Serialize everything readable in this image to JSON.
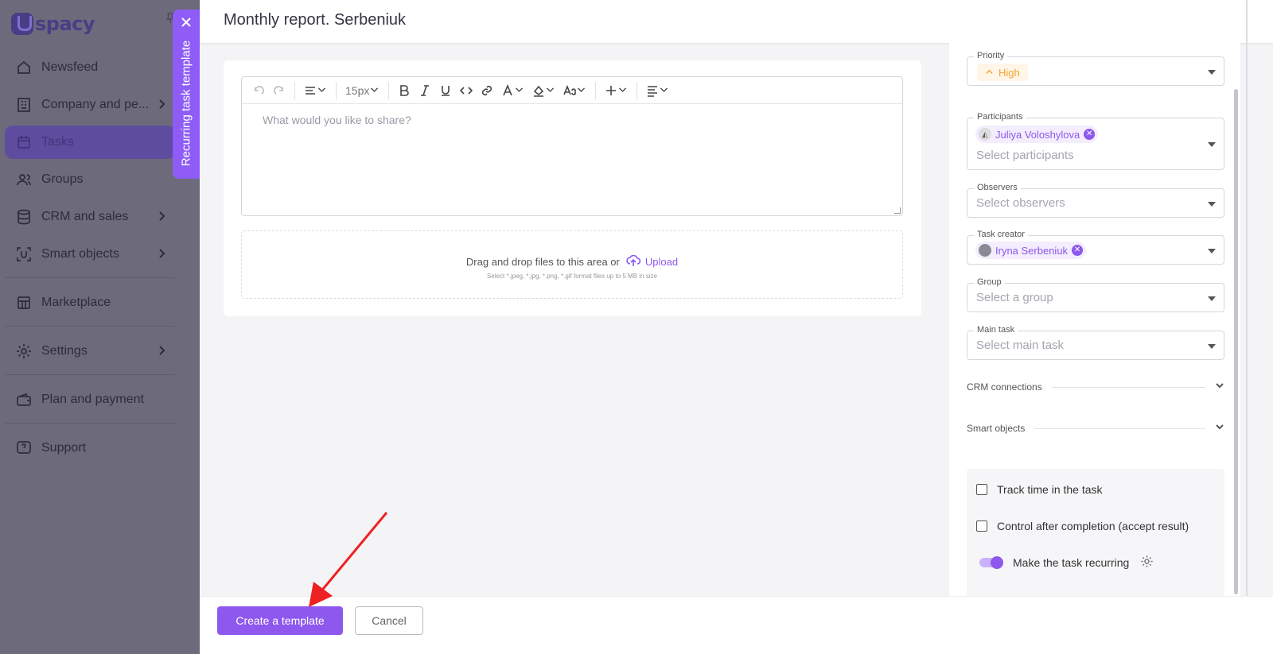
{
  "app": {
    "logo_text": "spacy"
  },
  "sidebar": {
    "items": [
      {
        "label": "Newsfeed",
        "icon": "home-icon"
      },
      {
        "label": "Company and pe...",
        "icon": "building-icon"
      },
      {
        "label": "Tasks",
        "icon": "calendar-icon"
      },
      {
        "label": "Groups",
        "icon": "users-icon"
      },
      {
        "label": "CRM and sales",
        "icon": "database-icon"
      },
      {
        "label": "Smart objects",
        "icon": "scan-icon"
      },
      {
        "label": "Marketplace",
        "icon": "store-icon"
      },
      {
        "label": "Settings",
        "icon": "gear-icon"
      },
      {
        "label": "Plan and payment",
        "icon": "wallet-icon"
      },
      {
        "label": "Support",
        "icon": "help-icon"
      }
    ]
  },
  "recurring_tab": {
    "label": "Recurring task template"
  },
  "panel": {
    "title": "Monthly report. Serbeniuk"
  },
  "editor": {
    "font_size": "15px",
    "placeholder": "What would you like to share?",
    "dropzone_text": "Drag and drop files to this area or",
    "upload_label": "Upload",
    "dropzone_hint": "Select *.jpeg, *.jpg, *.png, *.gif format files up to 5 MB in size"
  },
  "settings": {
    "priority": {
      "label": "Priority",
      "value": "High"
    },
    "participants": {
      "label": "Participants",
      "chip": "Juliya Voloshylova",
      "placeholder": "Select participants"
    },
    "observers": {
      "label": "Observers",
      "placeholder": "Select observers"
    },
    "task_creator": {
      "label": "Task creator",
      "chip": "Iryna Serbeniuk"
    },
    "group": {
      "label": "Group",
      "placeholder": "Select a group"
    },
    "main_task": {
      "label": "Main task",
      "placeholder": "Select main task"
    },
    "crm_connections": "CRM connections",
    "smart_objects": "Smart objects",
    "options": {
      "track_time": "Track time in the task",
      "control_after": "Control after completion (accept result)",
      "recurring": "Make the task recurring"
    }
  },
  "footer": {
    "create_label": "Create a template",
    "cancel_label": "Cancel"
  },
  "colors": {
    "accent": "#8e58ee",
    "priority_high": "#f4a42e",
    "overlay": "#6d6a7b"
  }
}
